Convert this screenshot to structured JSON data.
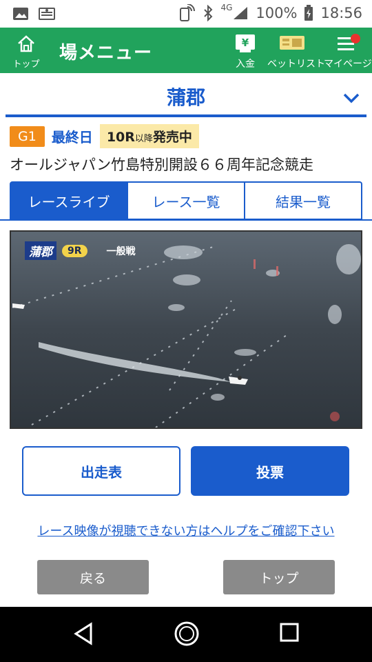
{
  "status": {
    "battery": "100%",
    "time": "18:56",
    "network": "4G"
  },
  "appbar": {
    "top_label": "トップ",
    "title": "場メニュー",
    "deposit_label": "入金",
    "betlist_label": "ベットリスト",
    "mypage_label": "マイページ"
  },
  "venue": {
    "name": "蒲郡"
  },
  "race": {
    "grade": "G1",
    "day_label": "最終日",
    "sale_race": "10R",
    "sale_suffix_small": "以降",
    "sale_status": "発売中",
    "title": "オールジャパン竹島特別開設６６周年記念競走"
  },
  "tabs": [
    {
      "label": "レースライブ",
      "active": true
    },
    {
      "label": "レース一覧",
      "active": false
    },
    {
      "label": "結果一覧",
      "active": false
    }
  ],
  "video": {
    "venue_overlay": "蒲郡",
    "race_overlay": "9R",
    "class_overlay": "一般戦"
  },
  "buttons": {
    "entries_label": "出走表",
    "vote_label": "投票",
    "help_link": "レース映像が視聴できない方はヘルプをご確認下さい",
    "back_label": "戻る",
    "top_label": "トップ"
  },
  "colors": {
    "green": "#21a35c",
    "blue": "#1a5ccc",
    "orange": "#f18c1a",
    "sale_bg": "#fbe9a8",
    "gray_button": "#8a8a8a"
  }
}
